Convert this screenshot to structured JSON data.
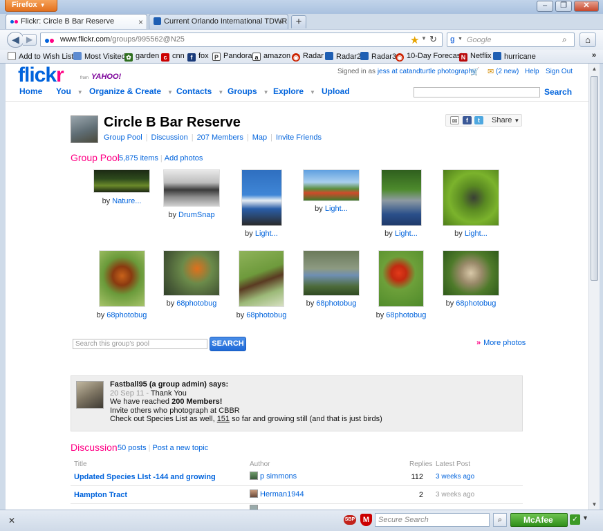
{
  "browser": {
    "app_button": "Firefox",
    "tabs": [
      {
        "title": "Flickr: Circle B Bar Reserve"
      },
      {
        "title": "Current Orlando International TDWR ..."
      }
    ],
    "new_tab": "+",
    "url_host": "www.flickr.com",
    "url_path": "/groups/995562@N25",
    "search_placeholder": "Google",
    "bookmarks": [
      "Add to Wish List",
      "Most Visited",
      "garden",
      "cnn",
      "fox",
      "Pandora",
      "amazon",
      "Radar",
      "Radar2",
      "Radar3",
      "10-Day Forecast",
      "Netflix",
      "hurricane"
    ],
    "bookmarks_overflow": "»"
  },
  "flickr": {
    "logo": {
      "part1": "flick",
      "part2": "r",
      "from": "from",
      "yahoo": "YAHOO!"
    },
    "account": {
      "signed_in_prefix": "Signed in as",
      "user": "jess at catandturtle photography",
      "mail_count": "(2 new)",
      "help": "Help",
      "signout": "Sign Out"
    },
    "nav": {
      "items": [
        "Home",
        "You",
        "Organize & Create",
        "Contacts",
        "Groups",
        "Explore",
        "Upload"
      ],
      "search_button": "Search"
    },
    "group": {
      "title": "Circle B Bar Reserve",
      "subnav": [
        "Group Pool",
        "Discussion",
        "207 Members",
        "Map",
        "Invite Friends"
      ],
      "share_label": "Share"
    },
    "pool": {
      "heading": "Group Pool",
      "count": "5,875 items",
      "add_photos": "Add photos",
      "photos": [
        {
          "by": "by",
          "author": "Nature..."
        },
        {
          "by": "by",
          "author": "DrumSnap"
        },
        {
          "by": "by",
          "author": "Light..."
        },
        {
          "by": "by",
          "author": "Light..."
        },
        {
          "by": "by",
          "author": "Light..."
        },
        {
          "by": "by",
          "author": "Light..."
        },
        {
          "by": "by",
          "author": "68photobug"
        },
        {
          "by": "by",
          "author": "68photobug"
        },
        {
          "by": "by",
          "author": "68photobug"
        },
        {
          "by": "by",
          "author": "68photobug"
        },
        {
          "by": "by",
          "author": "68photobug"
        },
        {
          "by": "by",
          "author": "68photobug"
        }
      ],
      "search_placeholder": "Search this group's pool",
      "search_button": "SEARCH",
      "more_photos_chev": "»",
      "more_photos": "More photos"
    },
    "admin_message": {
      "author_line": "Fastball95 (a group admin) says:",
      "date": "20 Sep 11",
      "subject": "Thank You",
      "line2_prefix": "We have reached ",
      "line2_bold": "200 Members!",
      "line3": "Invite others who photograph at CBBR",
      "line4_prefix": "Check out Species List as well, ",
      "line4_link": "151",
      "line4_suffix": " so far and growing still (and that is just birds)"
    },
    "discussion": {
      "heading": "Discussion",
      "count": "50 posts",
      "new_topic": "Post a new topic",
      "columns": [
        "Title",
        "Author",
        "Replies",
        "Latest Post"
      ],
      "rows": [
        {
          "title": "Updated Species LIst -144 and growing",
          "author": "p simmons",
          "replies": "112",
          "latest": "3 weeks ago"
        },
        {
          "title": "Hampton Tract",
          "author": "Herman1944",
          "replies": "2",
          "latest": "3 weeks ago"
        }
      ]
    }
  },
  "statusbar": {
    "close": "✕",
    "sbp": "SBP",
    "secure_search_placeholder": "Secure Search",
    "mcafee": "McAfee"
  }
}
